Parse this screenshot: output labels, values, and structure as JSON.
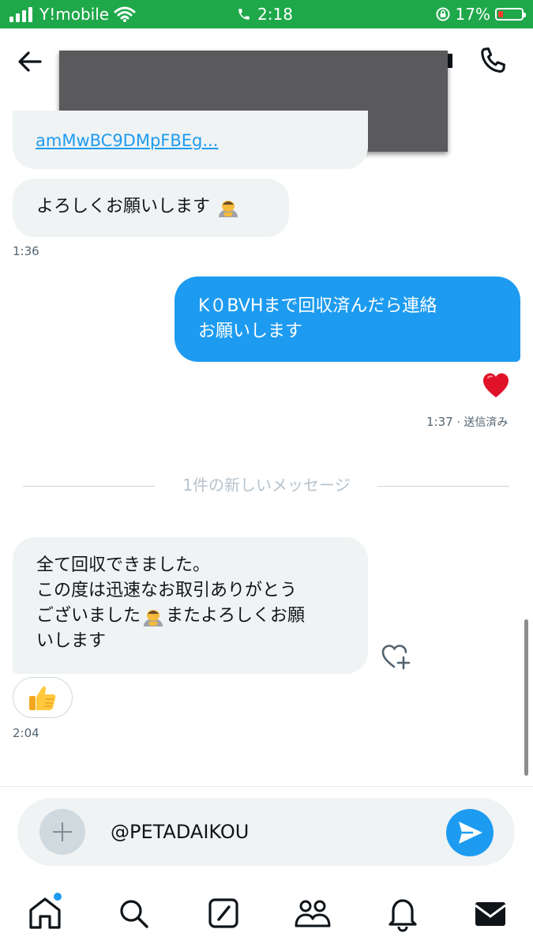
{
  "status_bar": {
    "carrier": "Y!mobile",
    "time": "2:18",
    "battery": "17%"
  },
  "header": {
    "title": "",
    "back_icon": "arrow-left-icon",
    "call_icon": "phone-icon"
  },
  "messages": {
    "m1_link": "amMwBC9DMpFBEg...",
    "m2_text": "よろしくお願いします",
    "m2_time": "1:36",
    "m3_line1": "K０BVHまで回収済んだら連絡",
    "m3_line2": "お願いします",
    "m3_reaction": "heart",
    "m3_time": "1:37",
    "m3_status": "· 送信済み",
    "divider": "1件の新しいメッセージ",
    "m4_line1": "全て回収できました。",
    "m4_line2": "この度は迅速なお取引ありがとう",
    "m4_line3a": "ございました",
    "m4_line3b": "またよろしくお願",
    "m4_line4": "いします",
    "m4_reaction": "thumbs-up",
    "m4_time": "2:04"
  },
  "composer": {
    "value": "@PETADAIKOU",
    "add_icon": "plus-icon",
    "send_icon": "send-icon"
  },
  "tab_bar": {
    "items": [
      "home-icon",
      "search-icon",
      "compose-icon",
      "people-icon",
      "bell-icon",
      "mail-icon"
    ],
    "active": "mail-icon"
  },
  "colors": {
    "status_bar": "#1ea84a",
    "accent": "#1d9bf0",
    "bubble_incoming": "#eff3f4"
  }
}
